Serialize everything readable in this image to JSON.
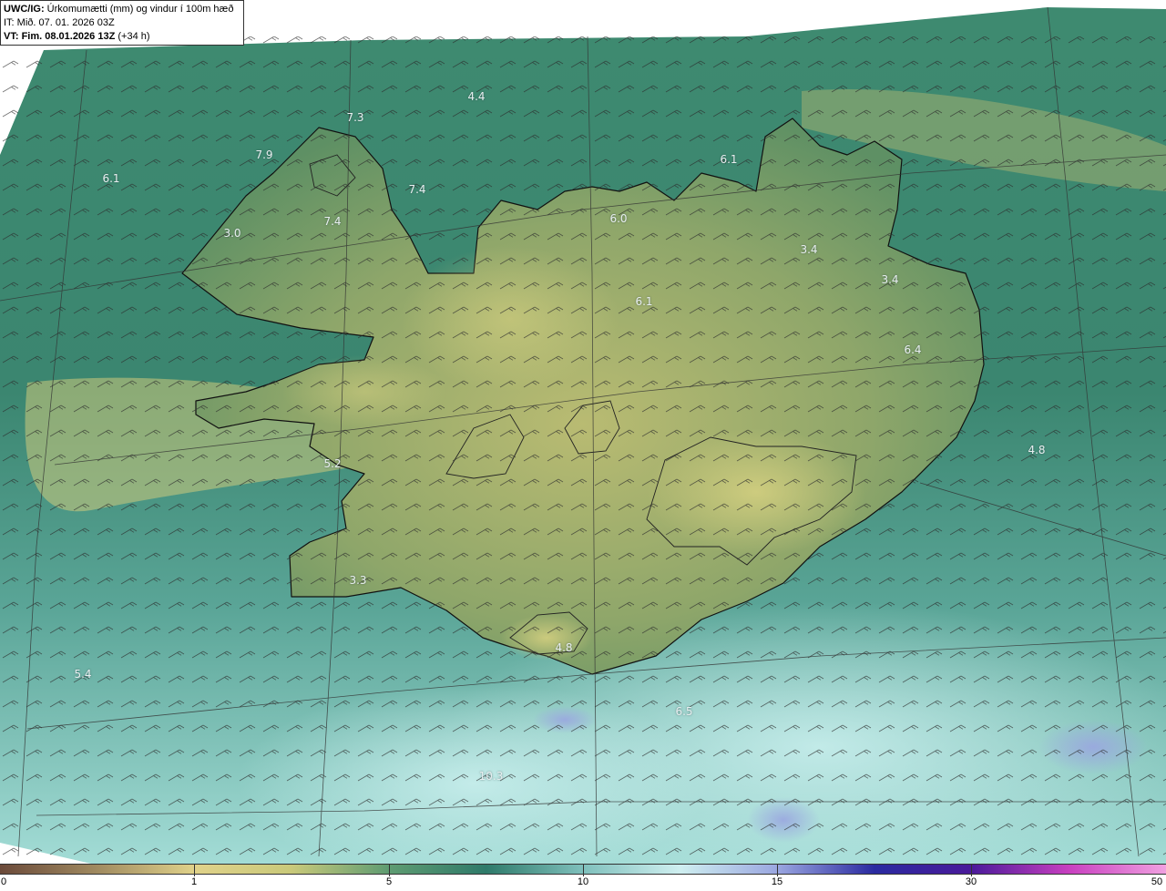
{
  "header": {
    "model": "UWC/IG:",
    "title": "Úrkomumætti (mm) og vindur í 100m hæð",
    "issue_time": "IT: Mið. 07. 01. 2026 03Z",
    "valid_label": "VT:",
    "valid_time": "Fim. 08.01.2026 13Z",
    "lead_time": "(+34 h)"
  },
  "map_values": [
    "4.4",
    "7.3",
    "7.9",
    "6.1",
    "7.4",
    "7.4",
    "3.0",
    "6.1",
    "6.0",
    "3.4",
    "3.4",
    "6.1",
    "6.4",
    "4.8",
    "5.2",
    "3.3",
    "5.4",
    "4.8",
    "6.5",
    "10.3"
  ],
  "colorbar": {
    "ticks": [
      "0",
      "1",
      "5",
      "10",
      "15",
      "30",
      "50"
    ],
    "colors": [
      "#6b4a3a",
      "#a08a60",
      "#e0d28a",
      "#c9c97a",
      "#5f9c72",
      "#2e7a6a",
      "#7fc0bc",
      "#cfeff0",
      "#9aa6e0",
      "#2a2aa0",
      "#4a1a9a",
      "#c840c0",
      "#f0a0e0"
    ]
  },
  "palette": {
    "sea_dark": "#2f7a6c",
    "sea_light": "#a6e2dc",
    "land_green": "#6e9a64",
    "land_yellow": "#c9c77a",
    "coast": "#111111"
  }
}
